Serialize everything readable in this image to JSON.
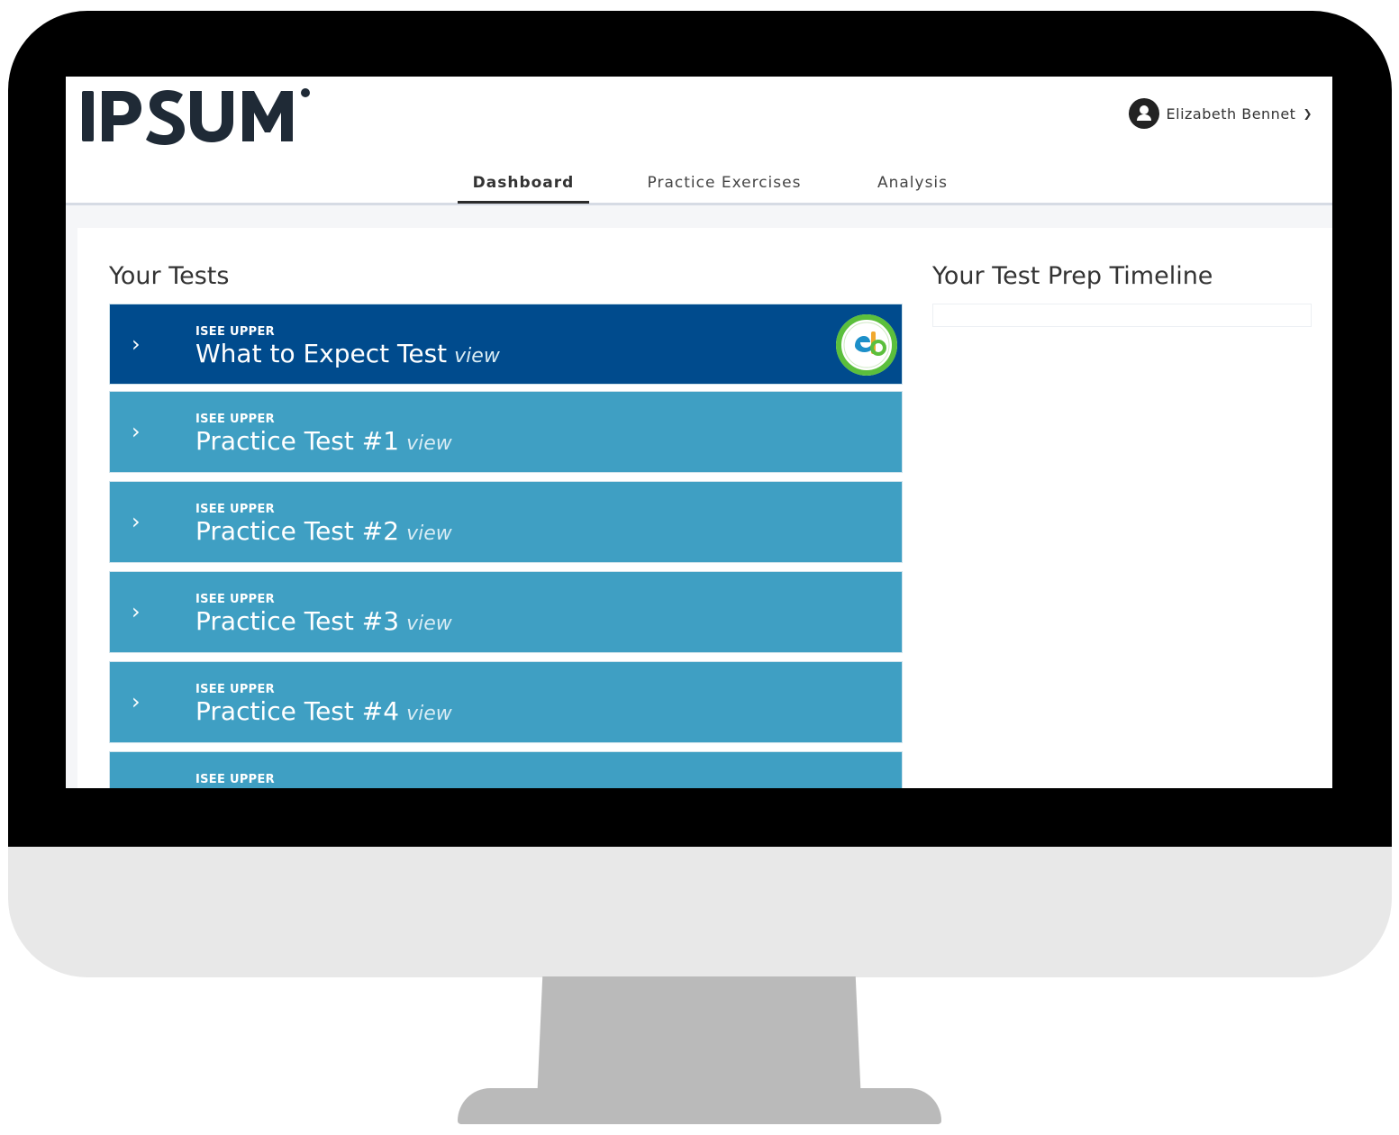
{
  "brand": {
    "logo_text": "IPSUM"
  },
  "user": {
    "name": "Elizabeth Bennet",
    "chevron": "chevron-down-icon"
  },
  "nav": {
    "items": [
      {
        "label": "Dashboard",
        "active": true
      },
      {
        "label": "Practice Exercises",
        "active": false
      },
      {
        "label": "Analysis",
        "active": false
      }
    ]
  },
  "tests_section": {
    "title": "Your Tests",
    "view_label": "view",
    "items": [
      {
        "kicker": "ISEE UPPER",
        "name": "What to Expect Test"
      },
      {
        "kicker": "ISEE UPPER",
        "name": "Practice Test #1"
      },
      {
        "kicker": "ISEE UPPER",
        "name": "Practice Test #2"
      },
      {
        "kicker": "ISEE UPPER",
        "name": "Practice Test #3"
      },
      {
        "kicker": "ISEE UPPER",
        "name": "Practice Test #4"
      },
      {
        "kicker": "ISEE UPPER",
        "name": ""
      }
    ]
  },
  "timeline_section": {
    "title": "Your Test Prep Timeline"
  },
  "colors": {
    "featured_test": "#004b8d",
    "test_row": "#3f9fc3",
    "badge_green": "#5bbf3c"
  }
}
